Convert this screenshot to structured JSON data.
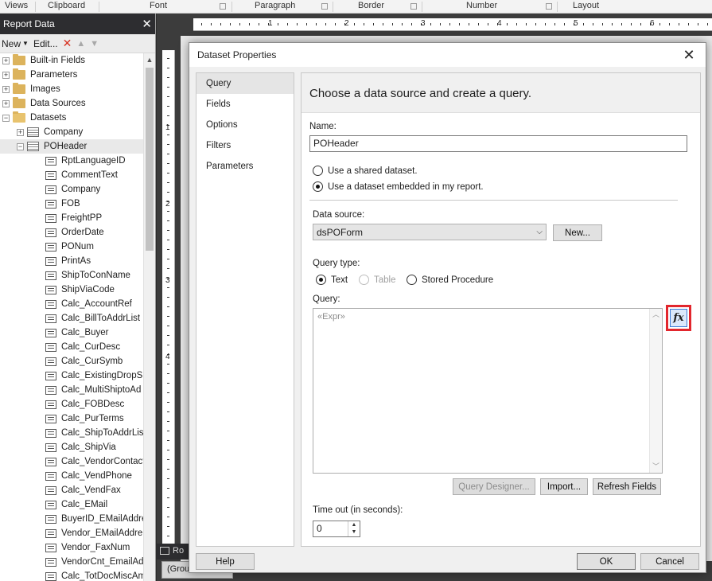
{
  "ribbon": {
    "groups": [
      "Views",
      "Clipboard",
      "Font",
      "Paragraph",
      "Border",
      "Number",
      "Layout"
    ]
  },
  "pane": {
    "title": "Report Data",
    "close_glyph": "✕",
    "toolbar": {
      "new_label": "New",
      "edit_label": "Edit..."
    },
    "tree": [
      {
        "label": "Built-in Fields",
        "level": 0,
        "type": "folder",
        "expanded": false
      },
      {
        "label": "Parameters",
        "level": 0,
        "type": "folder",
        "expanded": false
      },
      {
        "label": "Images",
        "level": 0,
        "type": "folder",
        "expanded": false
      },
      {
        "label": "Data Sources",
        "level": 0,
        "type": "folder",
        "expanded": false
      },
      {
        "label": "Datasets",
        "level": 0,
        "type": "folder",
        "expanded": true
      },
      {
        "label": "Company",
        "level": 1,
        "type": "table",
        "expanded": false
      },
      {
        "label": "POHeader",
        "level": 1,
        "type": "table",
        "expanded": true,
        "selected": true
      },
      {
        "label": "RptLanguageID",
        "level": 2,
        "type": "field"
      },
      {
        "label": "CommentText",
        "level": 2,
        "type": "field"
      },
      {
        "label": "Company",
        "level": 2,
        "type": "field"
      },
      {
        "label": "FOB",
        "level": 2,
        "type": "field"
      },
      {
        "label": "FreightPP",
        "level": 2,
        "type": "field"
      },
      {
        "label": "OrderDate",
        "level": 2,
        "type": "field"
      },
      {
        "label": "PONum",
        "level": 2,
        "type": "field"
      },
      {
        "label": "PrintAs",
        "level": 2,
        "type": "field"
      },
      {
        "label": "ShipToConName",
        "level": 2,
        "type": "field"
      },
      {
        "label": "ShipViaCode",
        "level": 2,
        "type": "field"
      },
      {
        "label": "Calc_AccountRef",
        "level": 2,
        "type": "field"
      },
      {
        "label": "Calc_BillToAddrList",
        "level": 2,
        "type": "field"
      },
      {
        "label": "Calc_Buyer",
        "level": 2,
        "type": "field"
      },
      {
        "label": "Calc_CurDesc",
        "level": 2,
        "type": "field"
      },
      {
        "label": "Calc_CurSymb",
        "level": 2,
        "type": "field"
      },
      {
        "label": "Calc_ExistingDropSh",
        "level": 2,
        "type": "field"
      },
      {
        "label": "Calc_MultiShiptoAd",
        "level": 2,
        "type": "field"
      },
      {
        "label": "Calc_FOBDesc",
        "level": 2,
        "type": "field"
      },
      {
        "label": "Calc_PurTerms",
        "level": 2,
        "type": "field"
      },
      {
        "label": "Calc_ShipToAddrList",
        "level": 2,
        "type": "field"
      },
      {
        "label": "Calc_ShipVia",
        "level": 2,
        "type": "field"
      },
      {
        "label": "Calc_VendorContact",
        "level": 2,
        "type": "field"
      },
      {
        "label": "Calc_VendPhone",
        "level": 2,
        "type": "field"
      },
      {
        "label": "Calc_VendFax",
        "level": 2,
        "type": "field"
      },
      {
        "label": "Calc_EMail",
        "level": 2,
        "type": "field"
      },
      {
        "label": "BuyerID_EMailAddre",
        "level": 2,
        "type": "field"
      },
      {
        "label": "Vendor_EMailAddre",
        "level": 2,
        "type": "field"
      },
      {
        "label": "Vendor_FaxNum",
        "level": 2,
        "type": "field"
      },
      {
        "label": "VendorCnt_EmailAd",
        "level": 2,
        "type": "field"
      },
      {
        "label": "Calc_TotDocMiscAm",
        "level": 2,
        "type": "field"
      }
    ]
  },
  "designer": {
    "ruler_numbers_top": [
      "1",
      "2",
      "3",
      "4",
      "5",
      "6"
    ],
    "ruler_numbers_left": [
      "1",
      "2",
      "3",
      "4"
    ],
    "tab_label": "Ro",
    "group_label": "(Grou"
  },
  "dialog": {
    "title": "Dataset Properties",
    "close_glyph": "✕",
    "nav": [
      "Query",
      "Fields",
      "Options",
      "Filters",
      "Parameters"
    ],
    "heading": "Choose a data source and create a query.",
    "name_label": "Name:",
    "name_value": "POHeader",
    "dataset_options": [
      {
        "label": "Use a shared dataset.",
        "checked": false
      },
      {
        "label": "Use a dataset embedded in my report.",
        "checked": true
      }
    ],
    "data_source_label": "Data source:",
    "data_source_value": "dsPOForm",
    "new_button": "New...",
    "query_type_label": "Query type:",
    "query_types": [
      {
        "label": "Text",
        "checked": true,
        "disabled": false
      },
      {
        "label": "Table",
        "checked": false,
        "disabled": true
      },
      {
        "label": "Stored Procedure",
        "checked": false,
        "disabled": false
      }
    ],
    "query_label": "Query:",
    "query_placeholder": "«Expr»",
    "fx_label": "fx",
    "query_designer_button": "Query Designer...",
    "import_button": "Import...",
    "refresh_button": "Refresh Fields",
    "timeout_label": "Time out (in seconds):",
    "timeout_value": "0",
    "help_button": "Help",
    "ok_button": "OK",
    "cancel_button": "Cancel"
  },
  "colors": {
    "highlight_border": "#e2262d",
    "pane_header": "#2d2d30",
    "delete_icon": "#d7301f"
  }
}
